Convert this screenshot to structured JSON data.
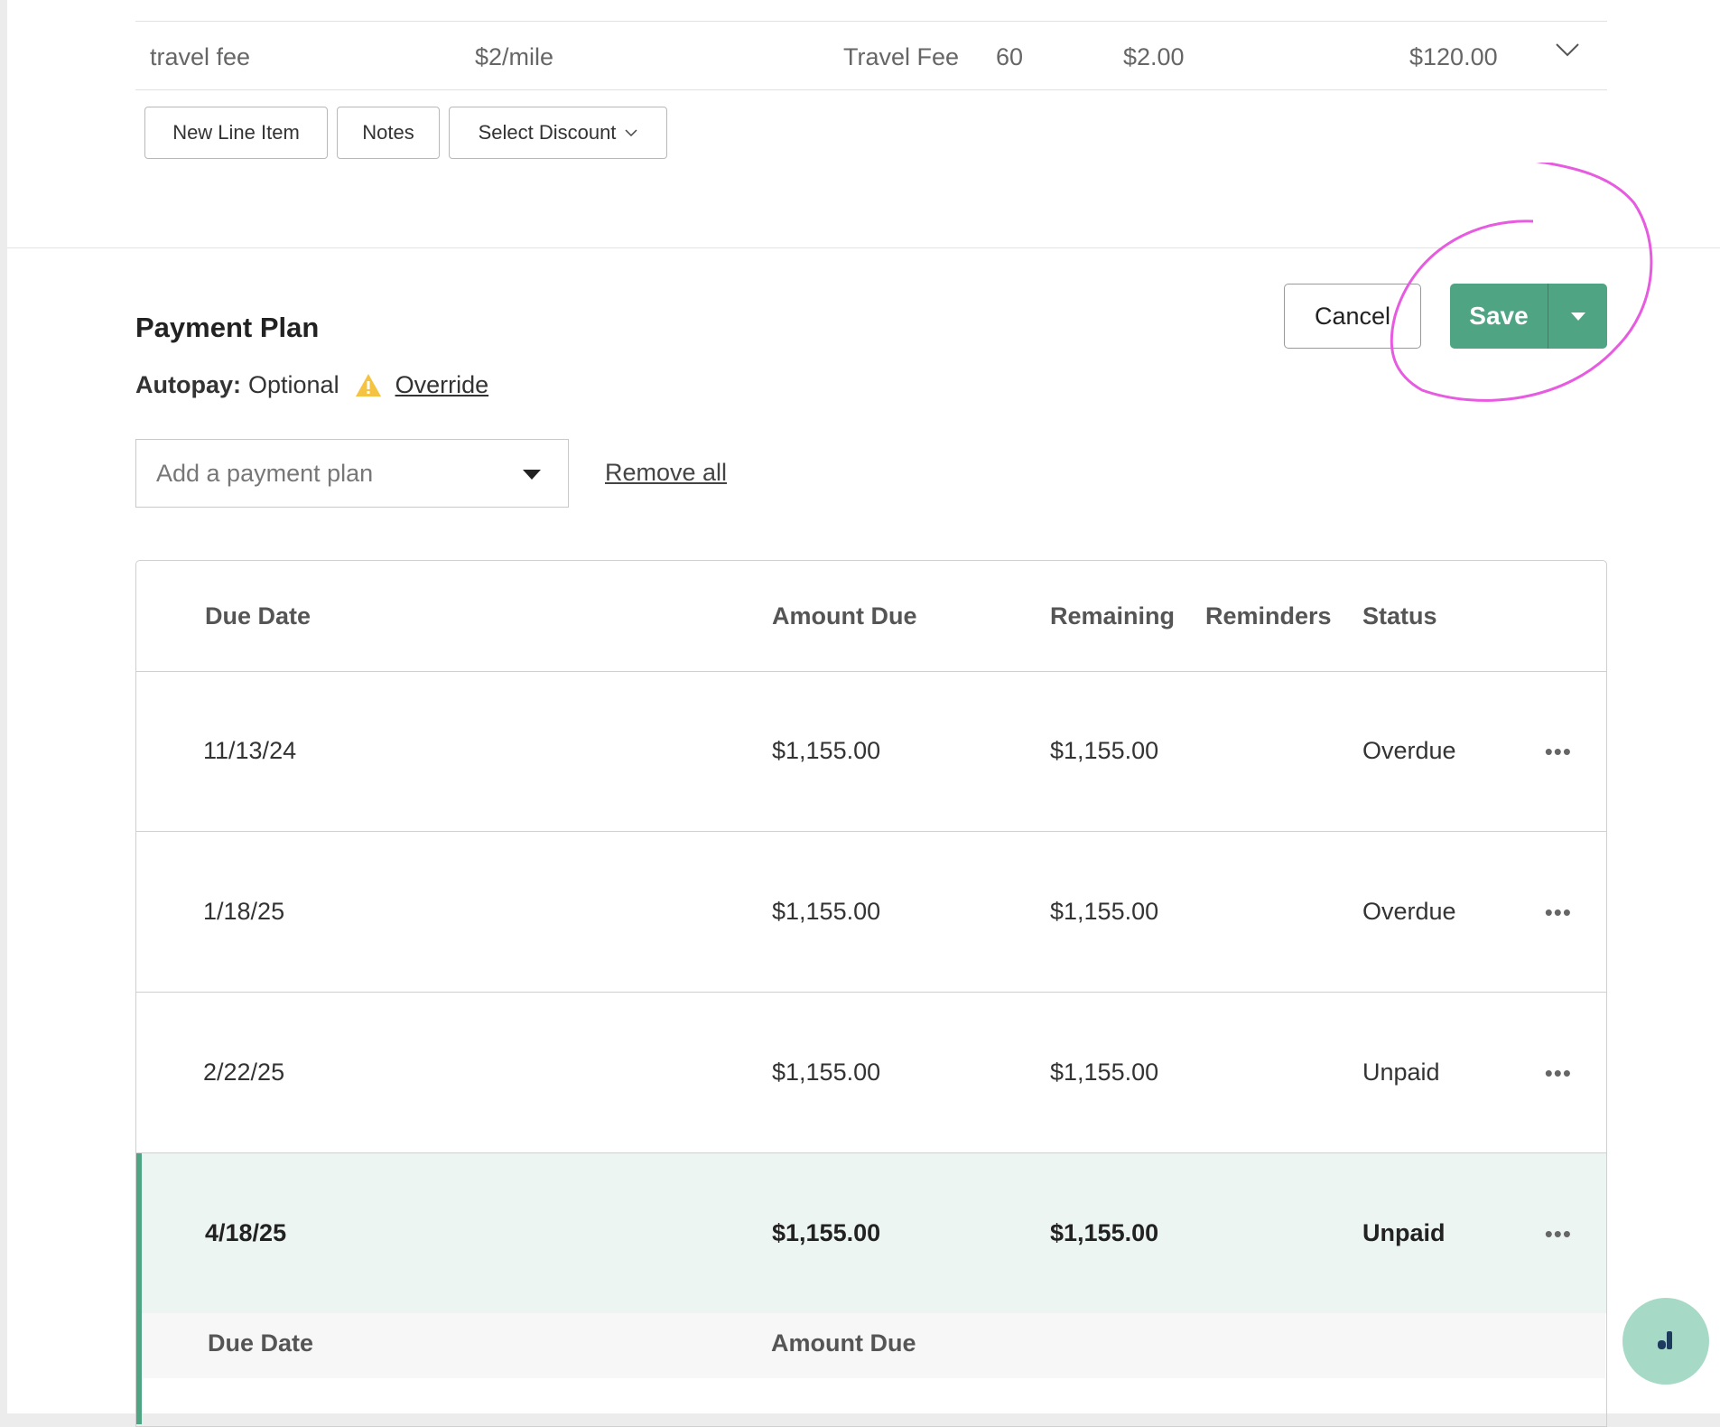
{
  "line_item": {
    "name": "travel fee",
    "rate_desc": "$2/mile",
    "type": "Travel Fee",
    "quantity": "60",
    "unit_price": "$2.00",
    "total": "$120.00"
  },
  "line_actions": {
    "new_line_item": "New Line Item",
    "notes": "Notes",
    "select_discount": "Select Discount"
  },
  "payment_plan": {
    "title": "Payment Plan",
    "autopay_label": "Autopay:",
    "autopay_value": "Optional",
    "override_link": "Override",
    "select_placeholder": "Add a payment plan",
    "remove_all": "Remove all"
  },
  "actions": {
    "cancel": "Cancel",
    "save": "Save"
  },
  "table": {
    "headers": {
      "due_date": "Due Date",
      "amount_due": "Amount Due",
      "remaining": "Remaining",
      "reminders": "Reminders",
      "status": "Status"
    },
    "rows": [
      {
        "due_date": "11/13/24",
        "amount_due": "$1,155.00",
        "remaining": "$1,155.00",
        "status": "Overdue"
      },
      {
        "due_date": "1/18/25",
        "amount_due": "$1,155.00",
        "remaining": "$1,155.00",
        "status": "Overdue"
      },
      {
        "due_date": "2/22/25",
        "amount_due": "$1,155.00",
        "remaining": "$1,155.00",
        "status": "Unpaid"
      },
      {
        "due_date": "4/18/25",
        "amount_due": "$1,155.00",
        "remaining": "$1,155.00",
        "status": "Unpaid"
      }
    ],
    "row_menu": "•••",
    "sub_headers": {
      "due_date": "Due Date",
      "amount_due": "Amount Due"
    }
  },
  "colors": {
    "accent_green": "#4ea483",
    "annotation_pink": "#e65be0",
    "warning_yellow": "#f5c342",
    "chat_fab": "#a7dac6"
  },
  "icons": {
    "line_expand": "chevron-down-icon",
    "autopay_warning": "warning-icon",
    "select_caret": "caret-down-icon",
    "save_menu": "caret-down-icon",
    "row_menu": "more-horizontal-icon",
    "chat": "chat-icon"
  }
}
